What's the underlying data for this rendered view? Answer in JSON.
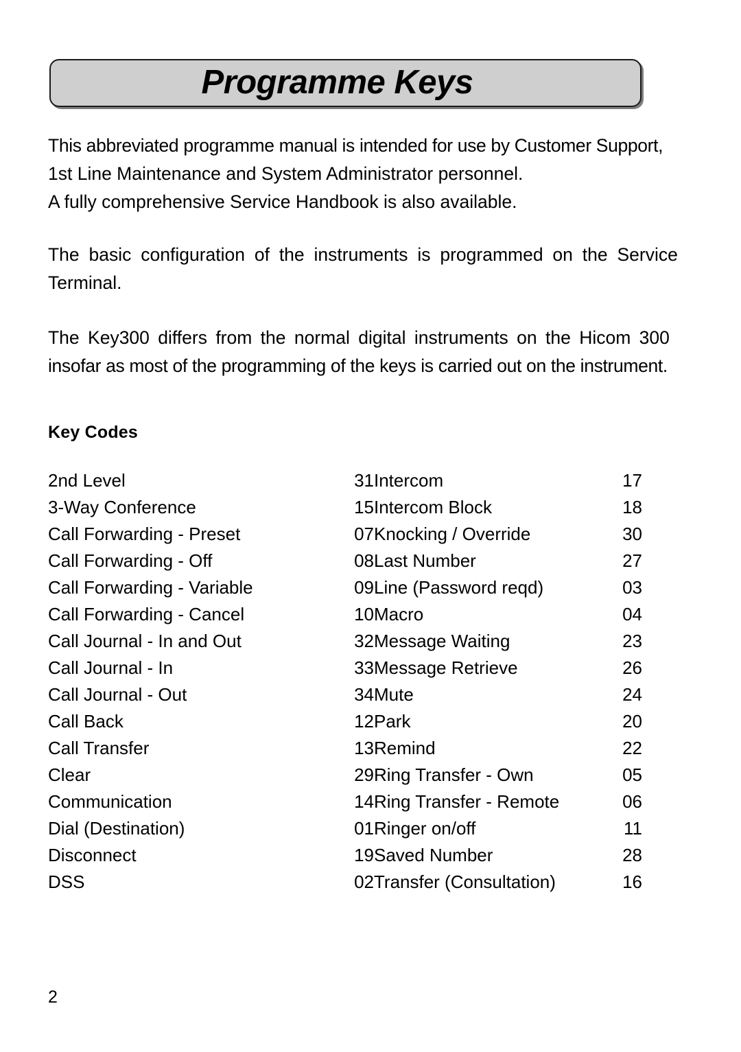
{
  "title": "Programme Keys",
  "paragraphs": [
    {
      "id": "intro",
      "lines": [
        "This abbreviated programme manual is intended for use by Customer Support,",
        "1st Line Maintenance and System Administrator personnel.",
        "A fully comprehensive Service Handbook is also available."
      ]
    },
    {
      "id": "configuration",
      "lines": [
        "The basic configuration of the instruments is programmed on the Service",
        "Terminal."
      ]
    },
    {
      "id": "key300",
      "lines": [
        "The  Key300 differs from the normal digital instruments on the Hicom 300",
        "insofar as most of the programming of the keys is carried out on the instrument."
      ]
    }
  ],
  "key_codes": {
    "heading": "Key Codes",
    "rows": [
      {
        "label_left": "2nd Level",
        "code_left": "31",
        "label_right": "Intercom",
        "code_right": "17"
      },
      {
        "label_left": "3-Way Conference",
        "code_left": "15",
        "label_right": "Intercom Block",
        "code_right": "18"
      },
      {
        "label_left": "Call Forwarding - Preset",
        "code_left": "07",
        "label_right": "Knocking / Override",
        "code_right": "30"
      },
      {
        "label_left": "Call Forwarding - Off",
        "code_left": "08",
        "label_right": "Last Number",
        "code_right": "27"
      },
      {
        "label_left": "Call Forwarding - Variable",
        "code_left": "09",
        "label_right": "Line (Password reqd)",
        "code_right": "03"
      },
      {
        "label_left": "Call Forwarding - Cancel",
        "code_left": "10",
        "label_right": "Macro",
        "code_right": "04"
      },
      {
        "label_left": "Call Journal - In and Out",
        "code_left": "32",
        "label_right": "Message Waiting",
        "code_right": "23"
      },
      {
        "label_left": "Call Journal - In",
        "code_left": "33",
        "label_right": "Message Retrieve",
        "code_right": "26"
      },
      {
        "label_left": "Call Journal - Out",
        "code_left": "34",
        "label_right": "Mute",
        "code_right": "24"
      },
      {
        "label_left": "Call Back",
        "code_left": "12",
        "label_right": "Park",
        "code_right": "20"
      },
      {
        "label_left": "Call Transfer",
        "code_left": "13",
        "label_right": "Remind",
        "code_right": "22"
      },
      {
        "label_left": "Clear",
        "code_left": "29",
        "label_right": "Ring Transfer - Own",
        "code_right": "05"
      },
      {
        "label_left": "Communication",
        "code_left": "14",
        "label_right": "Ring Transfer - Remote",
        "code_right": "06"
      },
      {
        "label_left": "Dial (Destination)",
        "code_left": "01",
        "label_right": "Ringer on/off",
        "code_right": "11"
      },
      {
        "label_left": "Disconnect",
        "code_left": "19",
        "label_right": "Saved Number",
        "code_right": "28"
      },
      {
        "label_left": "DSS",
        "code_left": "02",
        "label_right": "Transfer (Consultation)",
        "code_right": "16"
      }
    ]
  },
  "page_number": "2",
  "colors": {
    "title_box_fill": "#cfcfcf",
    "title_box_border": "#1a1a1a",
    "text": "#000000",
    "page_background": "#ffffff"
  }
}
